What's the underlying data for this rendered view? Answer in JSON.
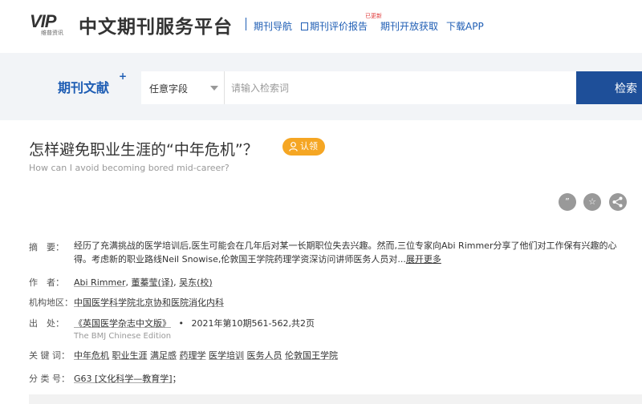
{
  "header": {
    "logo_mark": "VIP",
    "logo_sub": "维普资讯",
    "site_title": "中文期刊服务平台",
    "badge_new": "已更新",
    "nav": [
      {
        "label": "期刊导航"
      },
      {
        "label": "期刊评价报告"
      },
      {
        "label": "期刊开放获取"
      },
      {
        "label": "下载APP"
      }
    ]
  },
  "search": {
    "brand": "期刊文献",
    "brand_plus": "+",
    "field": "任意字段",
    "placeholder": "请输入检索词",
    "button": "检索"
  },
  "article": {
    "title": "怎样避免职业生涯的“中年危机”？",
    "claim": "认领",
    "title_en": "How can I avoid becoming bored mid-career?",
    "actions": [
      "quote",
      "favorite",
      "share"
    ]
  },
  "meta": {
    "abstract_label": "摘　要：",
    "abstract": "经历了充满挑战的医学培训后,医生可能会在几年后对某一长期职位失去兴趣。然而,三位专家向Abi Rimmer分享了他们对工作保有兴趣的心得。考虑新的职业路线Neil Snowise,伦敦国王学院药理学资深访问讲师医务人员对...",
    "abstract_more": "展开更多",
    "author_label": "作　者：",
    "authors": [
      "Abi Rimmer",
      "董蓁莹(译)",
      "吴东(校)"
    ],
    "author_sep1": ", ",
    "author_sep2": ", ",
    "org_label": "机构地区：",
    "org": "中国医学科学院北京协和医院消化内科",
    "source_label": "出　处：",
    "journal": "《英国医学杂志中文版》",
    "source_sep": "•",
    "issue": "2021年第10期561-562,共2页",
    "journal_en": "The BMJ Chinese Edition",
    "keywords_label": "关 键 词：",
    "keywords": [
      "中年危机",
      "职业生涯",
      "满足感",
      "药理学",
      "医学培训",
      "医务人员",
      "伦敦国王学院"
    ],
    "class_label": "分 类 号：",
    "class_value": "G63 [文化科学—教育学]",
    "class_suffix": "；"
  },
  "colors": {
    "brand_blue": "#1e5db4",
    "search_button": "#1e4f99",
    "claim": "#f5a623",
    "band": "#f2f4f7"
  }
}
